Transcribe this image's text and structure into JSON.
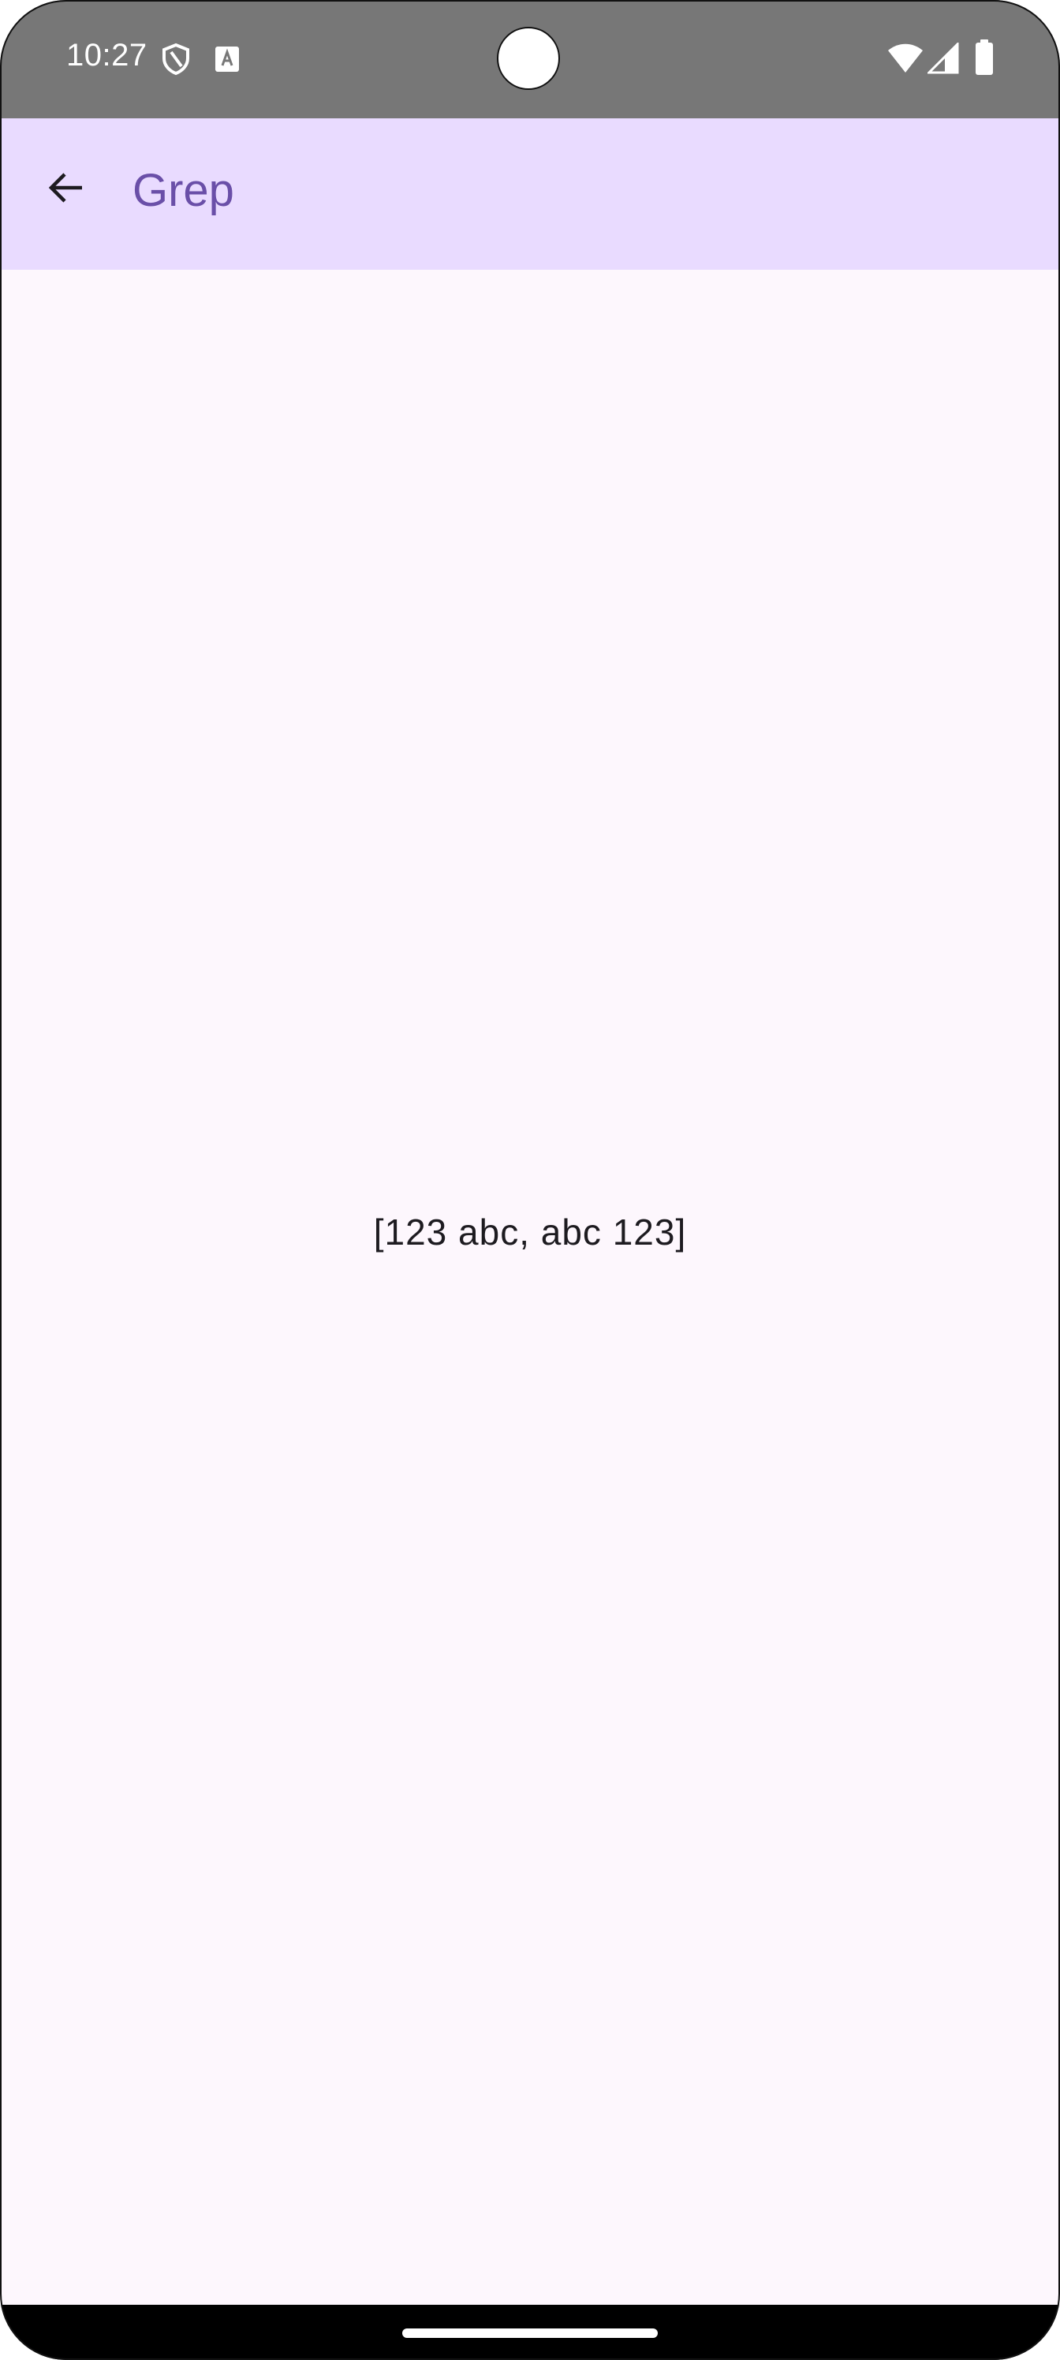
{
  "status_bar": {
    "time": "10:27",
    "icons": [
      "shield-icon",
      "accessibility-a-icon",
      "wifi-icon",
      "cellular-signal-icon",
      "battery-icon"
    ]
  },
  "app_bar": {
    "back_icon": "arrow-back-icon",
    "title": "Grep"
  },
  "main": {
    "result_text": "[123 abc, abc 123]"
  },
  "colors": {
    "status_bar_bg": "#777777",
    "app_bar_bg": "#e9dbff",
    "title_color": "#6a4fa8",
    "background": "#fdf7fd",
    "text_color": "#1d1b20"
  }
}
